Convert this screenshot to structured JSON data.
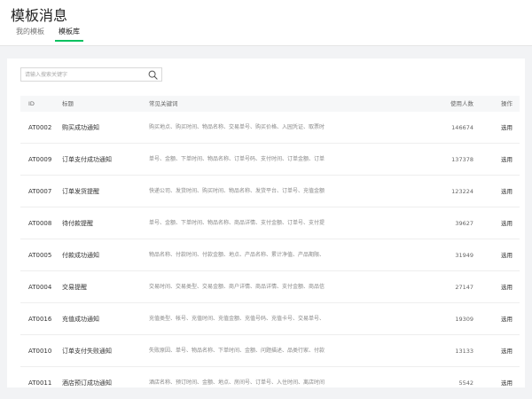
{
  "page": {
    "title": "模板消息"
  },
  "tabs": [
    {
      "label": "我的模板"
    },
    {
      "label": "模板库"
    }
  ],
  "search": {
    "placeholder": "请输入搜索关键字",
    "value": ""
  },
  "table": {
    "headers": {
      "id": "ID",
      "title": "标题",
      "keywords": "常见关键词",
      "usage": "使用人数",
      "action": "操作"
    },
    "rows": [
      {
        "id": "AT0002",
        "title": "购买成功通知",
        "keywords": "购买地点、购买时间、物品名称、交易单号、购买价格、入园凭证、取票时",
        "usage": "146674",
        "action": "选用"
      },
      {
        "id": "AT0009",
        "title": "订单支付成功通知",
        "keywords": "单号、金额、下单时间、物品名称、订单号码、支付时间、订单金额、订单",
        "usage": "137378",
        "action": "选用"
      },
      {
        "id": "AT0007",
        "title": "订单发货提醒",
        "keywords": "快递公司、发货时间、购买时间、物品名称、发货平台、订单号、充值金额",
        "usage": "123224",
        "action": "选用"
      },
      {
        "id": "AT0008",
        "title": "待付款提醒",
        "keywords": "单号、金额、下单时间、物品名称、商品详情、支付金额、订单号、支付提",
        "usage": "39627",
        "action": "选用"
      },
      {
        "id": "AT0005",
        "title": "付款成功通知",
        "keywords": "物品名称、付款时间、付款金额、地点、产品名称、累计净值、产品期限、",
        "usage": "31949",
        "action": "选用"
      },
      {
        "id": "AT0004",
        "title": "交易提醒",
        "keywords": "交易时间、交易类型、交易金额、商户详情、商品详情、支付金额、商品信",
        "usage": "27147",
        "action": "选用"
      },
      {
        "id": "AT0016",
        "title": "充值成功通知",
        "keywords": "充值类型、帐号、充值时间、充值金额、充值号码、充值卡号、交易单号、",
        "usage": "19309",
        "action": "选用"
      },
      {
        "id": "AT0010",
        "title": "订单支付失败通知",
        "keywords": "失败原因、单号、物品名称、下单时间、金额、问题描述、品类行家、付款",
        "usage": "13133",
        "action": "选用"
      },
      {
        "id": "AT0011",
        "title": "酒店预订成功通知",
        "keywords": "酒店名称、预订时间、金额、地点、房间号、订单号、入住时间、离店时间",
        "usage": "5542",
        "action": "选用"
      }
    ]
  }
}
